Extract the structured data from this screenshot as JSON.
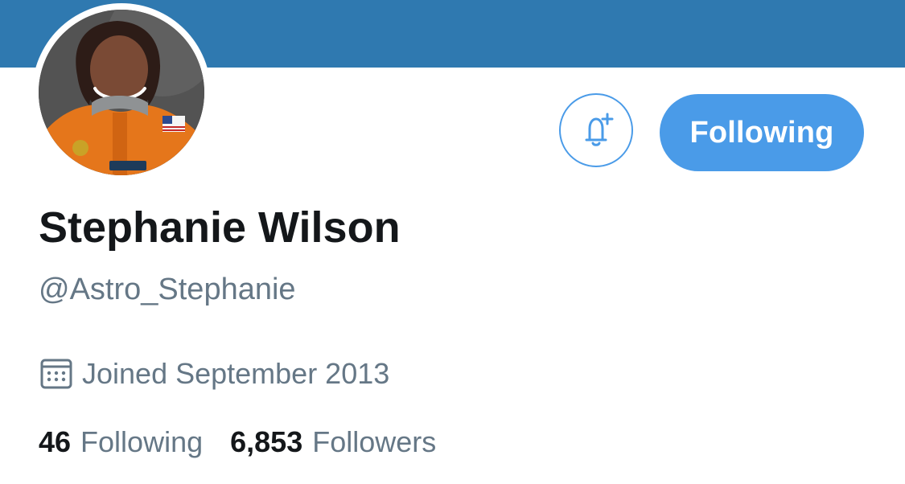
{
  "profile": {
    "name": "Stephanie Wilson",
    "handle": "@Astro_Stephanie",
    "joined": "Joined September 2013",
    "follow_button_label": "Following",
    "stats": {
      "following_count": "46",
      "following_label": "Following",
      "followers_count": "6,853",
      "followers_label": "Followers"
    }
  },
  "icons": {
    "notifications": "bell-plus-icon",
    "joined": "calendar-icon"
  },
  "colors": {
    "banner": "#2f79b0",
    "accent": "#4a9be8",
    "primary_text": "#14171a",
    "secondary_text": "#657786"
  }
}
